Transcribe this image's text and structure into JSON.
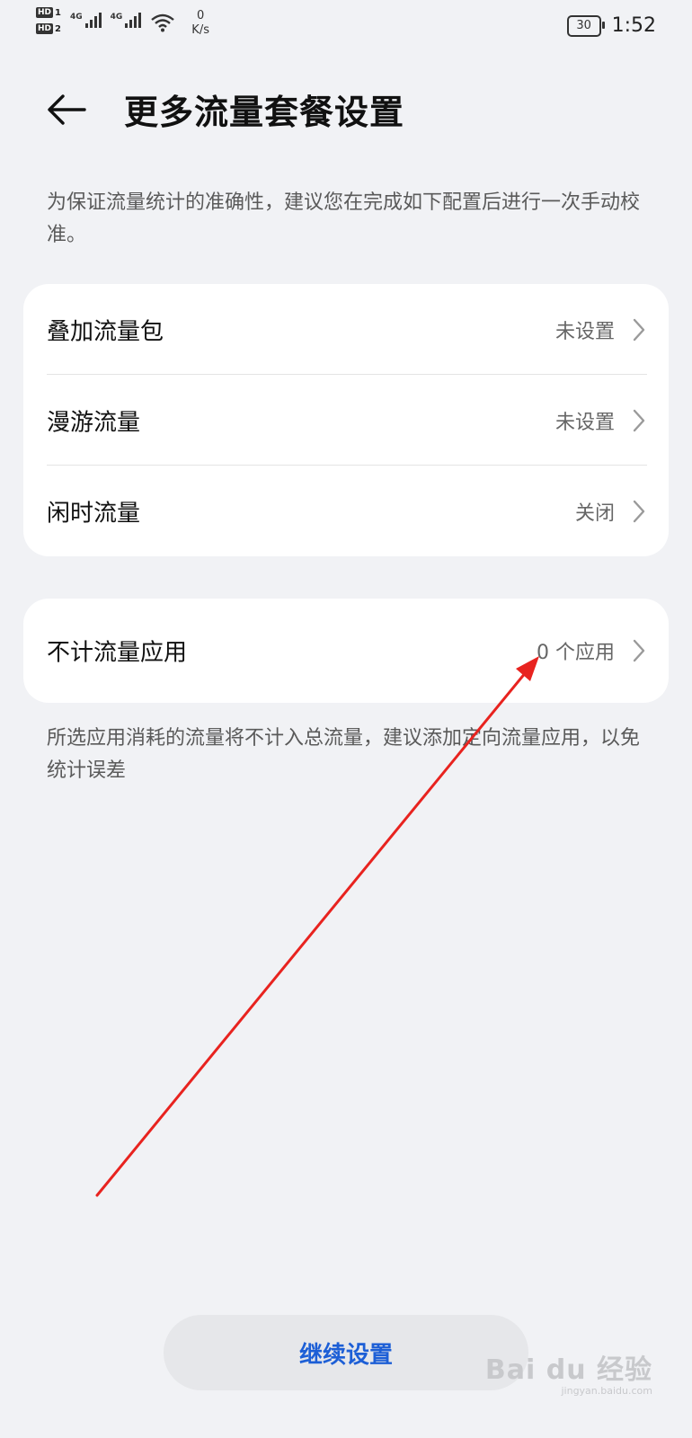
{
  "status_bar": {
    "hd1": "HD",
    "hd1_num": "1",
    "hd2": "HD",
    "hd2_num": "2",
    "net1": "4G",
    "net2": "4G",
    "speed_value": "0",
    "speed_unit": "K/s",
    "battery": "30",
    "time": "1:52"
  },
  "header": {
    "title": "更多流量套餐设置"
  },
  "intro_text": "为保证流量统计的准确性，建议您在完成如下配置后进行一次手动校准。",
  "settings_group": [
    {
      "label": "叠加流量包",
      "value": "未设置"
    },
    {
      "label": "漫游流量",
      "value": "未设置"
    },
    {
      "label": "闲时流量",
      "value": "关闭"
    }
  ],
  "exempt_apps": {
    "label": "不计流量应用",
    "value": "0 个应用"
  },
  "exempt_note": "所选应用消耗的流量将不计入总流量，建议添加定向流量应用，以免统计误差",
  "continue_button": "继续设置",
  "watermark": {
    "main": "Bai du 经验",
    "sub": "jingyan.baidu.com"
  },
  "colors": {
    "background": "#f1f2f5",
    "accent": "#1d5fd6",
    "annotation": "#e8231f"
  },
  "icons": [
    "back-arrow-icon",
    "chevron-right-icon",
    "wifi-icon",
    "signal-icon",
    "battery-icon"
  ]
}
